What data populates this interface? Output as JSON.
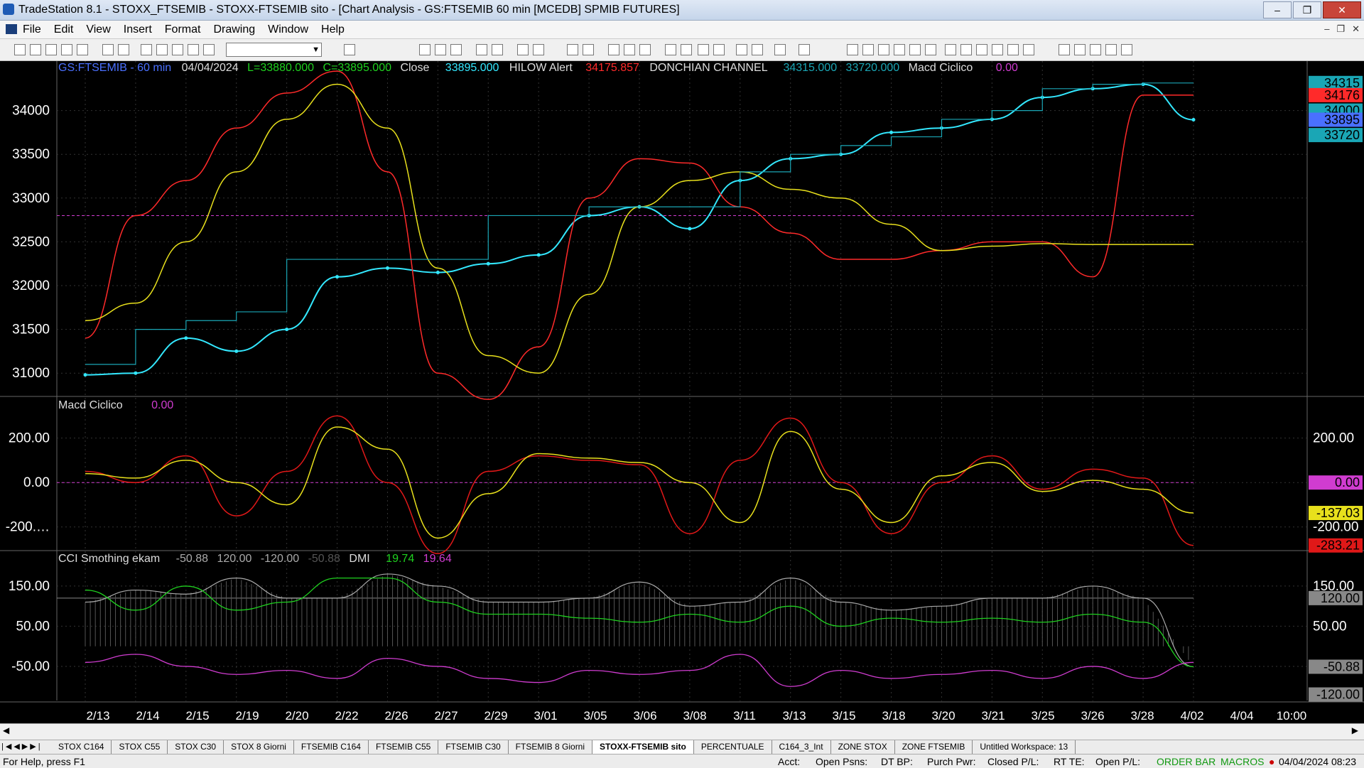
{
  "window": {
    "title": "TradeStation 8.1 - STOXX_FTSEMIB - STOXX-FTSEMIB sito - [Chart Analysis - GS:FTSEMIB  60 min  [MCEDB] SPMIB FUTURES]",
    "min": "–",
    "max": "❐",
    "close": "✕"
  },
  "menu": [
    "File",
    "Edit",
    "View",
    "Insert",
    "Format",
    "Drawing",
    "Window",
    "Help"
  ],
  "mdi_controls": [
    "–",
    "❐",
    "✕"
  ],
  "toolbar": {
    "combo_value": ""
  },
  "colors": {
    "background": "#000000",
    "price": "#33e8ff",
    "donchian": "#1aa6b5",
    "macd_red": "#e01818",
    "macd_yellow": "#e8e01c",
    "hilow": "#ff2a2a",
    "magenta": "#d03cd0",
    "green": "#1fd11f",
    "grid": "#333333"
  },
  "panel1": {
    "header": {
      "symbol": "GS:FTSEMIB - 60 min",
      "date": "04/04/2024",
      "low": "L=33880.000",
      "close": "C=33895.000",
      "close_label": "Close",
      "close_value": "33895.000",
      "hilow_label": "HILOW Alert",
      "hilow_value": "34175.857",
      "donchian_label": "DONCHIAN CHANNEL",
      "donchian_hi": "34315.000",
      "donchian_lo": "33720.000",
      "macd_label": "Macd Ciclico",
      "macd_value": "0.00"
    },
    "axis_ticks": [
      "34000",
      "33500",
      "33000",
      "32500",
      "32000",
      "31500",
      "31000"
    ],
    "badges": [
      "34315",
      "34176",
      "34000",
      "33895",
      "33720"
    ]
  },
  "panel2": {
    "header": {
      "label": "Macd Ciclico",
      "value": "0.00"
    },
    "axis_ticks": [
      "200.00",
      "0.00",
      "-200.…"
    ],
    "right_ticks": [
      "200.00",
      "-200.00"
    ],
    "badges": [
      "0.00",
      "-137.03",
      "-283.21"
    ]
  },
  "panel3": {
    "header": {
      "label": "CCI Smothing ekam",
      "v1": "-50.88",
      "v2": "120.00",
      "v3": "-120.00",
      "v4": "-50.88",
      "dmi_label": "DMI",
      "dmi1": "19.74",
      "dmi2": "19.64"
    },
    "axis_ticks": [
      "150.00",
      "50.00",
      "-50.00"
    ],
    "right_ticks": [
      "150.00",
      "50.00"
    ],
    "badges": [
      "120.00",
      "-50.88",
      "-120.00"
    ]
  },
  "x_axis": [
    "2/13",
    "2/14",
    "2/15",
    "2/19",
    "2/20",
    "2/22",
    "2/26",
    "2/27",
    "2/29",
    "3/01",
    "3/05",
    "3/06",
    "3/08",
    "3/11",
    "3/13",
    "3/15",
    "3/18",
    "3/20",
    "3/21",
    "3/25",
    "3/26",
    "3/28",
    "4/02",
    "4/04",
    "10:00"
  ],
  "tabs": [
    "STOX C164",
    "STOX C55",
    "STOX  C30",
    "STOX  8 Giorni",
    "FTSEMIB C164",
    "FTSEMIB C55",
    "FTSEMIB C30",
    "FTSEMIB  8 Giorni",
    "STOXX-FTSEMIB sito",
    "PERCENTUALE",
    "C164_3_Int",
    "ZONE STOX",
    "ZONE FTSEMIB",
    "Untitled Workspace:  13"
  ],
  "active_tab": "STOXX-FTSEMIB sito",
  "status": {
    "help": "For Help, press F1",
    "acct": "Acct:",
    "open_psns": "Open Psns:",
    "dt_bp": "DT BP:",
    "purch_pwr": "Purch Pwr:",
    "closed_pl": "Closed P/L:",
    "rt_te": "RT TE:",
    "open_pl": "Open P/L:",
    "order_bar": "ORDER BAR",
    "macros": "MACROS",
    "datetime": "04/04/2024 08:23"
  },
  "chart_data": {
    "type": "line",
    "x_labels": [
      "2/13",
      "2/14",
      "2/15",
      "2/19",
      "2/20",
      "2/22",
      "2/26",
      "2/27",
      "2/29",
      "3/01",
      "3/05",
      "3/06",
      "3/08",
      "3/11",
      "3/13",
      "3/15",
      "3/18",
      "3/20",
      "3/21",
      "3/25",
      "3/26",
      "3/28",
      "4/02"
    ],
    "panels": [
      {
        "name": "price",
        "ylim": [
          30750,
          34500
        ],
        "series": [
          {
            "name": "Close",
            "values": [
              30980,
              31000,
              31400,
              31250,
              31500,
              32100,
              32200,
              32150,
              32250,
              32350,
              32800,
              32900,
              32650,
              33200,
              33450,
              33500,
              33750,
              33800,
              33900,
              34150,
              34250,
              34300,
              33895
            ]
          },
          {
            "name": "HILOW Alert",
            "values": [
              31400,
              32800,
              33200,
              33800,
              34200,
              34450,
              33300,
              31000,
              30700,
              31300,
              33000,
              33450,
              33400,
              32900,
              32600,
              32300,
              32300,
              32400,
              32500,
              32500,
              32100,
              34176,
              34176
            ]
          },
          {
            "name": "Macd Ciclico",
            "values": [
              31600,
              31800,
              32500,
              33300,
              33900,
              34300,
              33800,
              32200,
              31200,
              31000,
              31900,
              32900,
              33200,
              33300,
              33100,
              33000,
              32700,
              32400,
              32450,
              32480,
              32470,
              32470,
              32470
            ]
          },
          {
            "name": "DONCHIAN CHANNEL",
            "values": [
              31100,
              31500,
              31600,
              31700,
              32300,
              32300,
              32300,
              32300,
              32800,
              32800,
              32900,
              32900,
              32900,
              33300,
              33500,
              33600,
              33700,
              33900,
              34000,
              34250,
              34300,
              34315,
              34315
            ]
          }
        ],
        "reference_line": 32800
      },
      {
        "name": "Macd Ciclico",
        "ylim": [
          -300,
          330
        ],
        "series": [
          {
            "name": "red",
            "values": [
              50,
              0,
              120,
              -150,
              50,
              300,
              0,
              -320,
              50,
              120,
              100,
              80,
              -230,
              100,
              290,
              0,
              -230,
              0,
              120,
              -30,
              60,
              20,
              -283.21
            ]
          },
          {
            "name": "yellow",
            "values": [
              40,
              20,
              100,
              0,
              -100,
              250,
              150,
              -250,
              -50,
              130,
              110,
              90,
              0,
              -180,
              230,
              -30,
              -180,
              30,
              90,
              -40,
              10,
              -30,
              -137.03
            ]
          }
        ]
      },
      {
        "name": "CCI Smothing ekam / DMI",
        "ylim": [
          -135,
          210
        ],
        "series": [
          {
            "name": "CCI",
            "values": [
              110,
              140,
              130,
              170,
              120,
              120,
              180,
              150,
              110,
              110,
              120,
              160,
              100,
              110,
              170,
              110,
              90,
              100,
              120,
              120,
              150,
              120,
              -50.88
            ]
          },
          {
            "name": "DMI1",
            "values": [
              140,
              90,
              150,
              90,
              110,
              170,
              170,
              110,
              80,
              80,
              70,
              60,
              80,
              60,
              100,
              50,
              70,
              60,
              70,
              60,
              80,
              60,
              -50.88
            ]
          },
          {
            "name": "DMI2",
            "values": [
              -40,
              -20,
              -50,
              -70,
              -60,
              -80,
              -30,
              -50,
              -80,
              -90,
              -60,
              -70,
              -60,
              -20,
              -100,
              -60,
              -80,
              -70,
              -60,
              -80,
              -50,
              -80,
              -40
            ]
          }
        ],
        "reference_line": 120
      }
    ]
  }
}
